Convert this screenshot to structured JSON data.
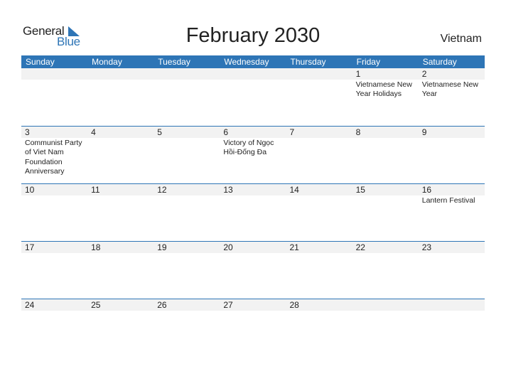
{
  "logo": {
    "line1": "General",
    "line2": "Blue"
  },
  "title": "February 2030",
  "country": "Vietnam",
  "colors": {
    "accent": "#2e75b6",
    "date_strip": "#f2f2f2"
  },
  "weekdays": [
    "Sunday",
    "Monday",
    "Tuesday",
    "Wednesday",
    "Thursday",
    "Friday",
    "Saturday"
  ],
  "weeks": [
    [
      {
        "day": "",
        "event": ""
      },
      {
        "day": "",
        "event": ""
      },
      {
        "day": "",
        "event": ""
      },
      {
        "day": "",
        "event": ""
      },
      {
        "day": "",
        "event": ""
      },
      {
        "day": "1",
        "event": "Vietnamese New Year Holidays"
      },
      {
        "day": "2",
        "event": "Vietnamese New Year"
      }
    ],
    [
      {
        "day": "3",
        "event": "Communist Party of Viet Nam Foundation Anniversary"
      },
      {
        "day": "4",
        "event": ""
      },
      {
        "day": "5",
        "event": ""
      },
      {
        "day": "6",
        "event": "Victory of Ngọc Hồi-Đống Đa"
      },
      {
        "day": "7",
        "event": ""
      },
      {
        "day": "8",
        "event": ""
      },
      {
        "day": "9",
        "event": ""
      }
    ],
    [
      {
        "day": "10",
        "event": ""
      },
      {
        "day": "11",
        "event": ""
      },
      {
        "day": "12",
        "event": ""
      },
      {
        "day": "13",
        "event": ""
      },
      {
        "day": "14",
        "event": ""
      },
      {
        "day": "15",
        "event": ""
      },
      {
        "day": "16",
        "event": "Lantern Festival"
      }
    ],
    [
      {
        "day": "17",
        "event": ""
      },
      {
        "day": "18",
        "event": ""
      },
      {
        "day": "19",
        "event": ""
      },
      {
        "day": "20",
        "event": ""
      },
      {
        "day": "21",
        "event": ""
      },
      {
        "day": "22",
        "event": ""
      },
      {
        "day": "23",
        "event": ""
      }
    ],
    [
      {
        "day": "24",
        "event": ""
      },
      {
        "day": "25",
        "event": ""
      },
      {
        "day": "26",
        "event": ""
      },
      {
        "day": "27",
        "event": ""
      },
      {
        "day": "28",
        "event": ""
      },
      {
        "day": "",
        "event": ""
      },
      {
        "day": "",
        "event": ""
      }
    ]
  ]
}
